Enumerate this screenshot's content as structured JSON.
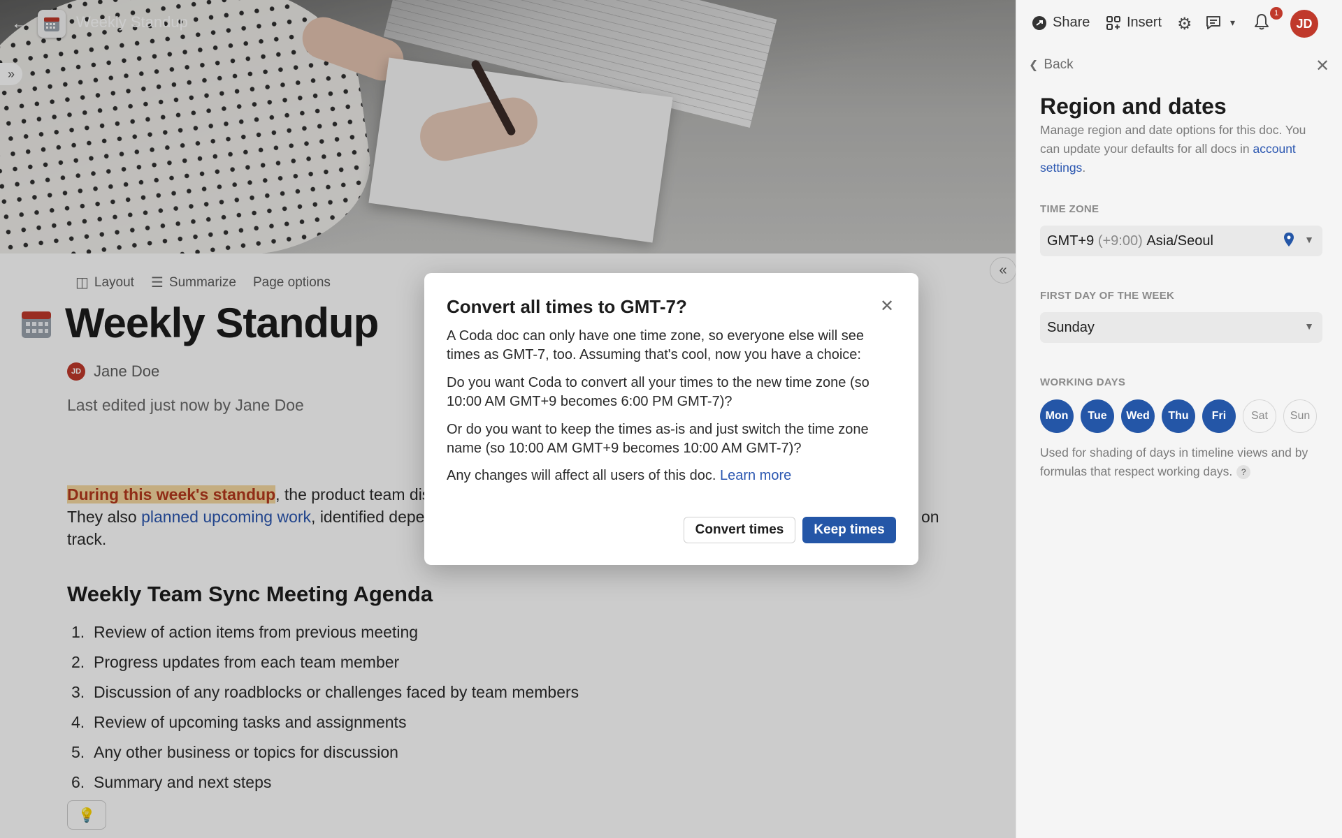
{
  "doc": {
    "title_small": "Weekly Standup",
    "page_title": "Weekly Standup",
    "author_initials": "JD",
    "author_name": "Jane Doe",
    "last_edited": "Last edited just now by Jane Doe",
    "toolbar": {
      "layout": "Layout",
      "summarize": "Summarize",
      "page_options": "Page options"
    },
    "paragraph": {
      "highlight": "During this week's standup",
      "part1": ", the product team discu",
      "part1_end": "",
      "line2_a": "They also ",
      "link": "planned upcoming work",
      "line2_b": ", identified depen",
      "line2_tail": "on",
      "line3": "track."
    },
    "agenda_title": "Weekly Team Sync Meeting Agenda",
    "agenda": [
      {
        "num": "1.",
        "text": "Review of action items from previous meeting"
      },
      {
        "num": "2.",
        "text": "Progress updates from each team member"
      },
      {
        "num": "3.",
        "text": "Discussion of any roadblocks or challenges faced by team members"
      },
      {
        "num": "4.",
        "text": "Review of upcoming tasks and assignments"
      },
      {
        "num": "5.",
        "text": "Any other business or topics for discussion"
      },
      {
        "num": "6.",
        "text": "Summary and next steps"
      }
    ]
  },
  "modal": {
    "title": "Convert all times to GMT-7?",
    "p1": "A Coda doc can only have one time zone, so everyone else will see times as GMT-7, too. Assuming that's cool, now you have a choice:",
    "p2": "Do you want Coda to convert all your times to the new time zone (so 10:00 AM GMT+9 becomes 6:00 PM GMT-7)?",
    "p3": "Or do you want to keep the times as-is and just switch the time zone name (so 10:00 AM GMT+9 becomes 10:00 AM GMT-7)?",
    "p4": "Any changes will affect all users of this doc.",
    "learn_more": "Learn more",
    "convert_label": "Convert times",
    "keep_label": "Keep times"
  },
  "panel": {
    "share": "Share",
    "insert": "Insert",
    "notification_count": "1",
    "avatar_initials": "JD",
    "back": "Back",
    "title": "Region and dates",
    "desc": "Manage region and date options for this doc. You can update your defaults for all docs in ",
    "desc_link": "account settings",
    "desc_end": ".",
    "time_zone_label": "TIME ZONE",
    "time_zone_prefix": "GMT+9",
    "time_zone_offset": "(+9:00)",
    "time_zone_name": "Asia/Seoul",
    "first_day_label": "FIRST DAY OF THE WEEK",
    "first_day_value": "Sunday",
    "working_days_label": "WORKING DAYS",
    "days": [
      {
        "label": "Mon",
        "on": true
      },
      {
        "label": "Tue",
        "on": true
      },
      {
        "label": "Wed",
        "on": true
      },
      {
        "label": "Thu",
        "on": true
      },
      {
        "label": "Fri",
        "on": true
      },
      {
        "label": "Sat",
        "on": false
      },
      {
        "label": "Sun",
        "on": false
      }
    ],
    "working_days_note": "Used for shading of days in timeline views and by formulas that respect working days.",
    "help_mark": "?"
  },
  "colors": {
    "accent": "#2456a7",
    "avatar": "#c0392b",
    "highlight_text": "#b5391d",
    "highlight_bg": "#f6d9a0"
  }
}
